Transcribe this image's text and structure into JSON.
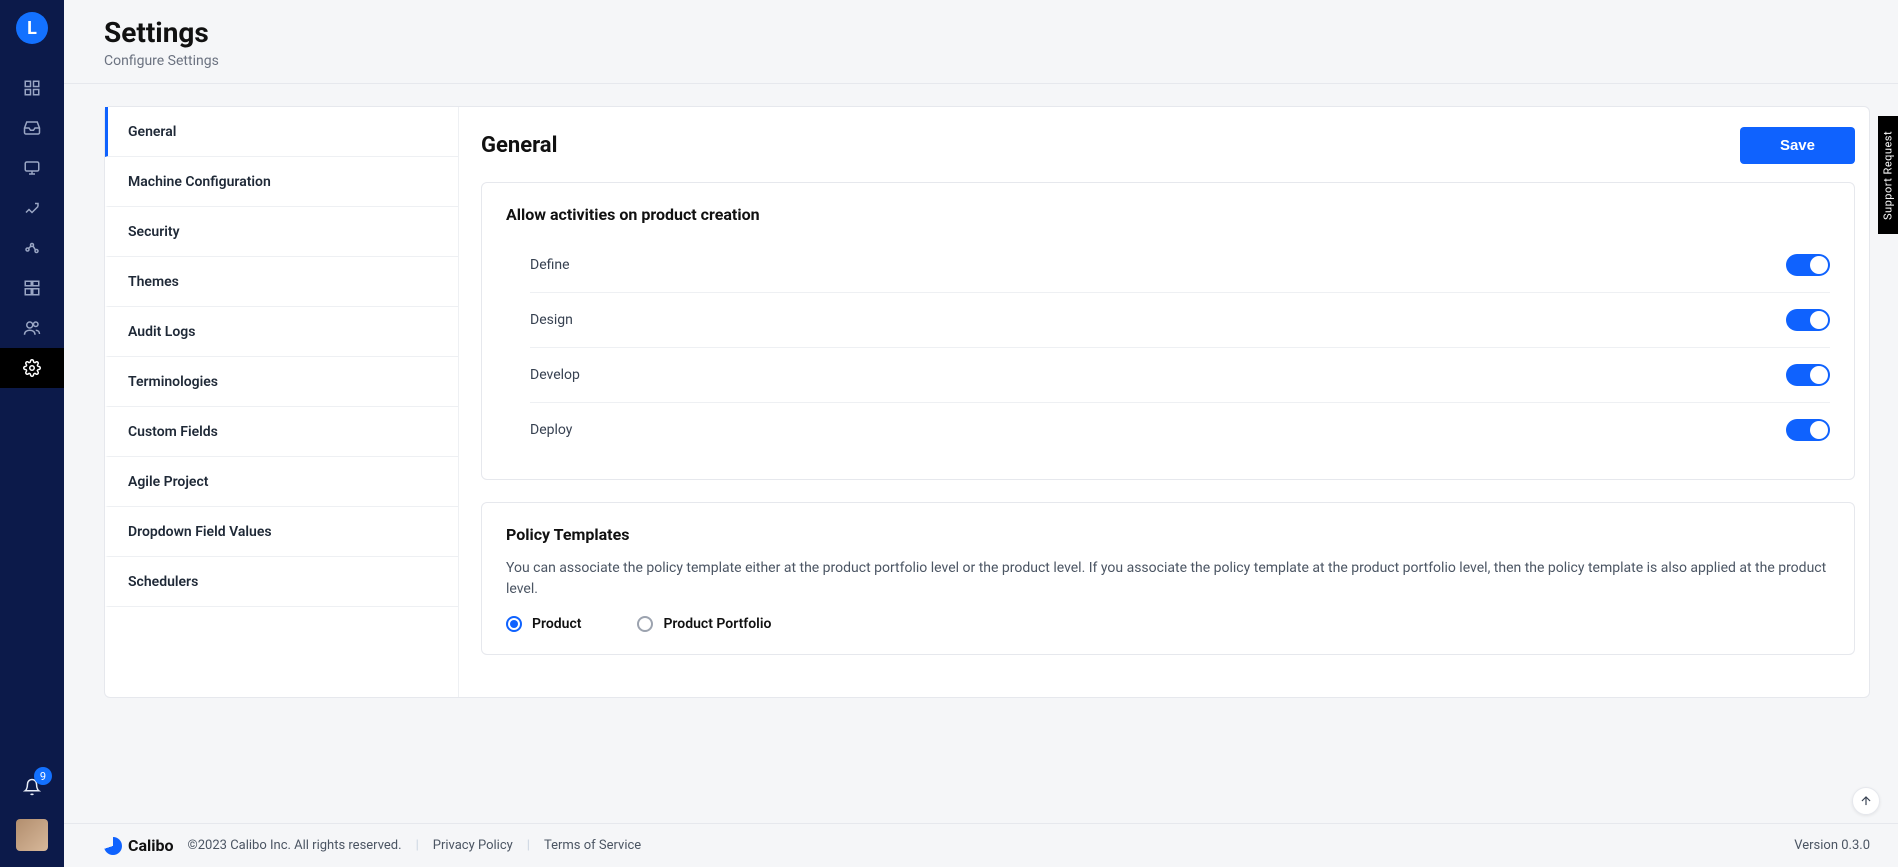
{
  "rail": {
    "logo_letter": "L",
    "notification_count": "9"
  },
  "header": {
    "title": "Settings",
    "subtitle": "Configure Settings"
  },
  "tabs": [
    {
      "label": "General"
    },
    {
      "label": "Machine Configuration"
    },
    {
      "label": "Security"
    },
    {
      "label": "Themes"
    },
    {
      "label": "Audit Logs"
    },
    {
      "label": "Terminologies"
    },
    {
      "label": "Custom Fields"
    },
    {
      "label": "Agile Project"
    },
    {
      "label": "Dropdown Field Values"
    },
    {
      "label": "Schedulers"
    }
  ],
  "panel": {
    "title": "General",
    "save_label": "Save",
    "activities_section_title": "Allow activities on product creation",
    "activities": [
      {
        "label": "Define"
      },
      {
        "label": "Design"
      },
      {
        "label": "Develop"
      },
      {
        "label": "Deploy"
      }
    ],
    "policy": {
      "title": "Policy Templates",
      "description": "You can associate the policy template either at the product portfolio level or the product level. If you associate the policy template at the product portfolio level, then the policy template is also applied at the product level.",
      "option_product": "Product",
      "option_portfolio": "Product Portfolio"
    }
  },
  "footer": {
    "brand": "Calibo",
    "copyright": "©2023 Calibo Inc. All rights reserved.",
    "privacy": "Privacy Policy",
    "terms": "Terms of Service",
    "version": "Version 0.3.0"
  },
  "support_label": "Support Request"
}
